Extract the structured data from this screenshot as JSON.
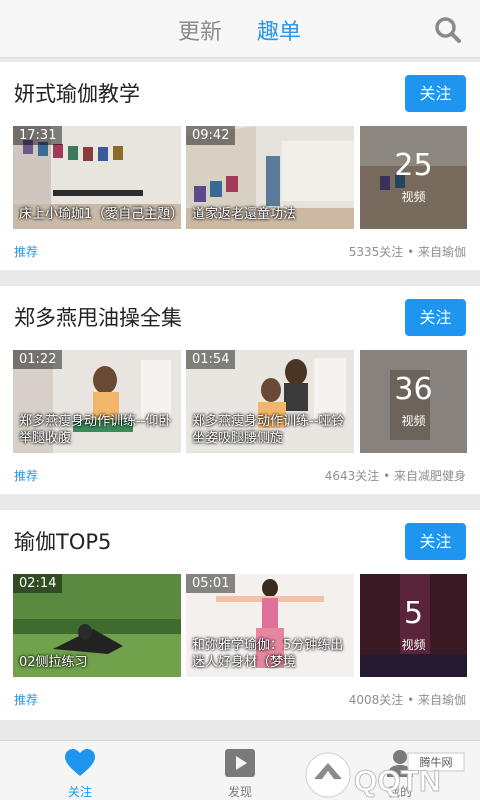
{
  "header": {
    "tabs": [
      {
        "label": "更新"
      },
      {
        "label": "趣单"
      }
    ],
    "active_tab": 1,
    "search_icon": "search-icon"
  },
  "cards": [
    {
      "title": "妍式瑜伽教学",
      "follow": "关注",
      "videos": [
        {
          "duration": "17:31",
          "caption": "床上小瑜珈1（愛自己主題）"
        },
        {
          "duration": "09:42",
          "caption": "道家返老還童功法"
        }
      ],
      "count": "25",
      "count_label": "视频",
      "tag": "推荐",
      "meta": "5335关注 • 来自瑜伽"
    },
    {
      "title": "郑多燕甩油操全集",
      "follow": "关注",
      "videos": [
        {
          "duration": "01:22",
          "caption": "郑多燕瘦身动作训练--仰卧举腿收腹"
        },
        {
          "duration": "01:54",
          "caption": "郑多燕瘦身动作训练--哑铃坐姿吸腿腰侧旋"
        }
      ],
      "count": "36",
      "count_label": "视频",
      "tag": "推荐",
      "meta": "4643关注 • 来自减肥健身"
    },
    {
      "title": "瑜伽TOP5",
      "follow": "关注",
      "videos": [
        {
          "duration": "02:14",
          "caption": "02侧拉练习"
        },
        {
          "duration": "05:01",
          "caption": "和弥雅学瑜伽：5分钟练出迷人好身材（梦境"
        }
      ],
      "count": "5",
      "count_label": "视频",
      "tag": "推荐",
      "meta": "4008关注 • 来自瑜伽"
    }
  ],
  "bottom_nav": [
    {
      "label": "关注",
      "icon": "heart-icon",
      "active": true
    },
    {
      "label": "发现",
      "icon": "play-icon",
      "active": false
    },
    {
      "label": "我的",
      "icon": "user-icon",
      "active": false
    }
  ],
  "watermark": {
    "text": "QQTN.com",
    "badge": "腾牛网"
  },
  "colors": {
    "accent": "#1e96f0",
    "tab_inactive": "#8b8b8b",
    "meta": "#8f8f8f"
  }
}
